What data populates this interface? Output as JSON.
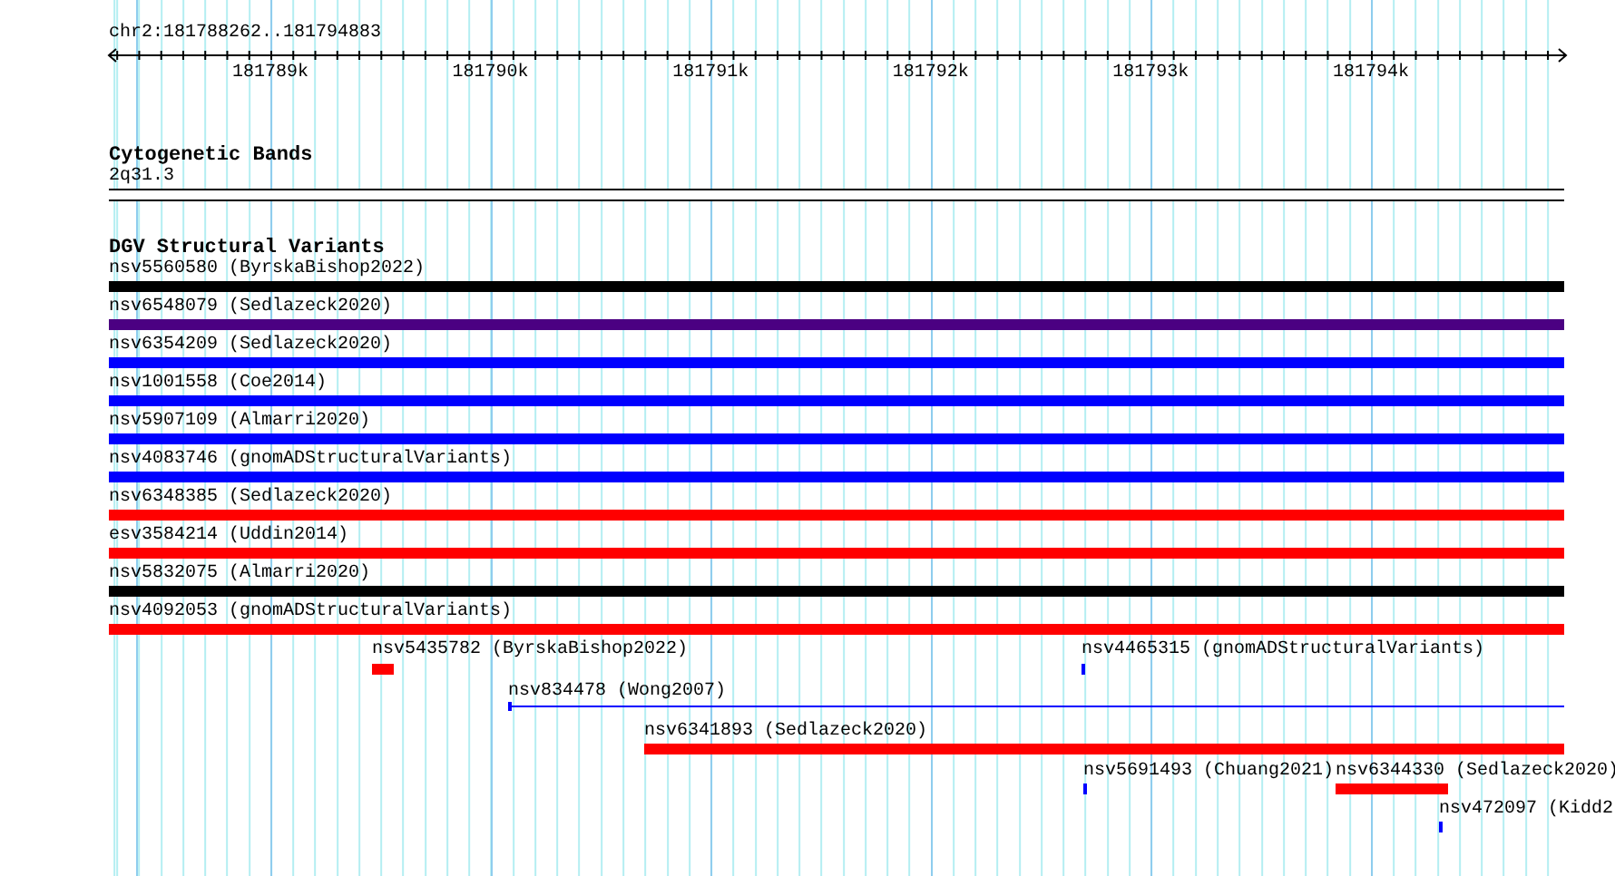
{
  "ruler": {
    "location": "chr2:181788262..181794883",
    "ticks": [
      "181789k",
      "181790k",
      "181791k",
      "181792k",
      "181793k",
      "181794k"
    ]
  },
  "cytoband_track": {
    "title": "Cytogenetic Bands",
    "band": "2q31.3"
  },
  "variant_track": {
    "title": "DGV Structural Variants",
    "features": [
      {
        "label": "nsv5560580 (ByrskaBishop2022)",
        "color": "#000000",
        "kind": "thick"
      },
      {
        "label": "nsv6548079 (Sedlazeck2020)",
        "color": "#4b0082",
        "kind": "thick"
      },
      {
        "label": "nsv6354209 (Sedlazeck2020)",
        "color": "#0000ff",
        "kind": "thick"
      },
      {
        "label": "nsv1001558 (Coe2014)",
        "color": "#0000ff",
        "kind": "thick"
      },
      {
        "label": "nsv5907109 (Almarri2020)",
        "color": "#0000ff",
        "kind": "thick"
      },
      {
        "label": "nsv4083746 (gnomADStructuralVariants)",
        "color": "#0000ff",
        "kind": "thick"
      },
      {
        "label": "nsv6348385 (Sedlazeck2020)",
        "color": "#ff0000",
        "kind": "thick"
      },
      {
        "label": "esv3584214 (Uddin2014)",
        "color": "#ff0000",
        "kind": "thick"
      },
      {
        "label": "nsv5832075 (Almarri2020)",
        "color": "#000000",
        "kind": "thick"
      },
      {
        "label": "nsv4092053 (gnomADStructuralVariants)",
        "color": "#ff0000",
        "kind": "thick"
      },
      {
        "label": "nsv5435782 (ByrskaBishop2022)",
        "color": "#ff0000",
        "kind": "thick"
      },
      {
        "label": "nsv4465315 (gnomADStructuralVariants)",
        "color": "#0000ff",
        "kind": "thick"
      },
      {
        "label": "nsv834478 (Wong2007)",
        "color": "#0000ff",
        "kind": "line"
      },
      {
        "label": "nsv6341893 (Sedlazeck2020)",
        "color": "#ff0000",
        "kind": "thick"
      },
      {
        "label": "nsv5691493 (Chuang2021)",
        "color": "#0000ff",
        "kind": "thick"
      },
      {
        "label": "nsv6344330 (Sedlazeck2020)",
        "color": "#ff0000",
        "kind": "thick"
      },
      {
        "label": "nsv472097 (Kidd2",
        "color": "#0000ff",
        "kind": "thick"
      }
    ]
  }
}
